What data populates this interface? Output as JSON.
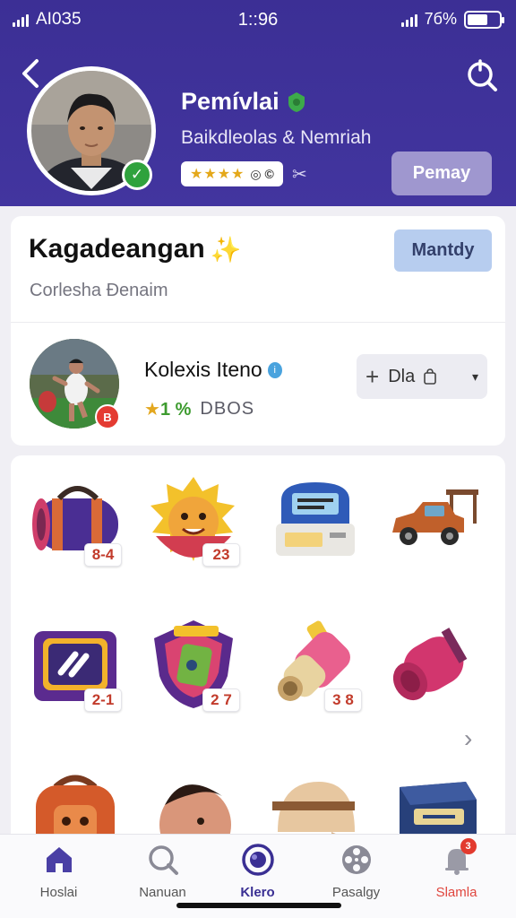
{
  "status_bar": {
    "carrier": "AI0З5",
    "time": "1::96",
    "battery": "7б%"
  },
  "header": {
    "name": "Pemívlai",
    "subtitle": "Baikdleolas & Nemriah",
    "rating_stars": "★★★★",
    "rating_extra": "◎ ©",
    "action_label": "Pemay"
  },
  "section": {
    "title": "Kagadeangan",
    "subtitle": "Corlesha Đenaim",
    "manage_label": "Mantdy"
  },
  "featured_item": {
    "name": "Kolexis Iteno",
    "percent": "1 %",
    "label": "DBOS",
    "dropdown_label": "Dla"
  },
  "grid_items": [
    {
      "icon": "sports-bag-icon",
      "qty": "8-4"
    },
    {
      "icon": "lion-mascot-icon",
      "qty": "23"
    },
    {
      "icon": "ticket-machine-icon",
      "qty": ""
    },
    {
      "icon": "toy-car-icon",
      "qty": ""
    },
    {
      "icon": "tablet-device-icon",
      "qty": "2-1"
    },
    {
      "icon": "shield-badge-icon",
      "qty": "2 7"
    },
    {
      "icon": "flashlight-icon",
      "qty": "3 8"
    },
    {
      "icon": "rolled-mat-icon",
      "qty": ""
    },
    {
      "icon": "backpack-icon",
      "qty": ""
    },
    {
      "icon": "character-head-icon",
      "qty": ""
    },
    {
      "icon": "cap-icon",
      "qty": ""
    },
    {
      "icon": "box-icon",
      "qty": ""
    }
  ],
  "bottom_nav": [
    {
      "label": "Hoslai",
      "icon": "home-icon"
    },
    {
      "label": "Nanuan",
      "icon": "search-icon"
    },
    {
      "label": "Klero",
      "icon": "ring-icon"
    },
    {
      "label": "Pasalgy",
      "icon": "film-reel-icon"
    },
    {
      "label": "Slamla",
      "icon": "bell-icon",
      "badge": "3"
    }
  ],
  "colors": {
    "header": "#3c2f95",
    "accent": "#3a2f93",
    "alert": "#e0463e"
  }
}
